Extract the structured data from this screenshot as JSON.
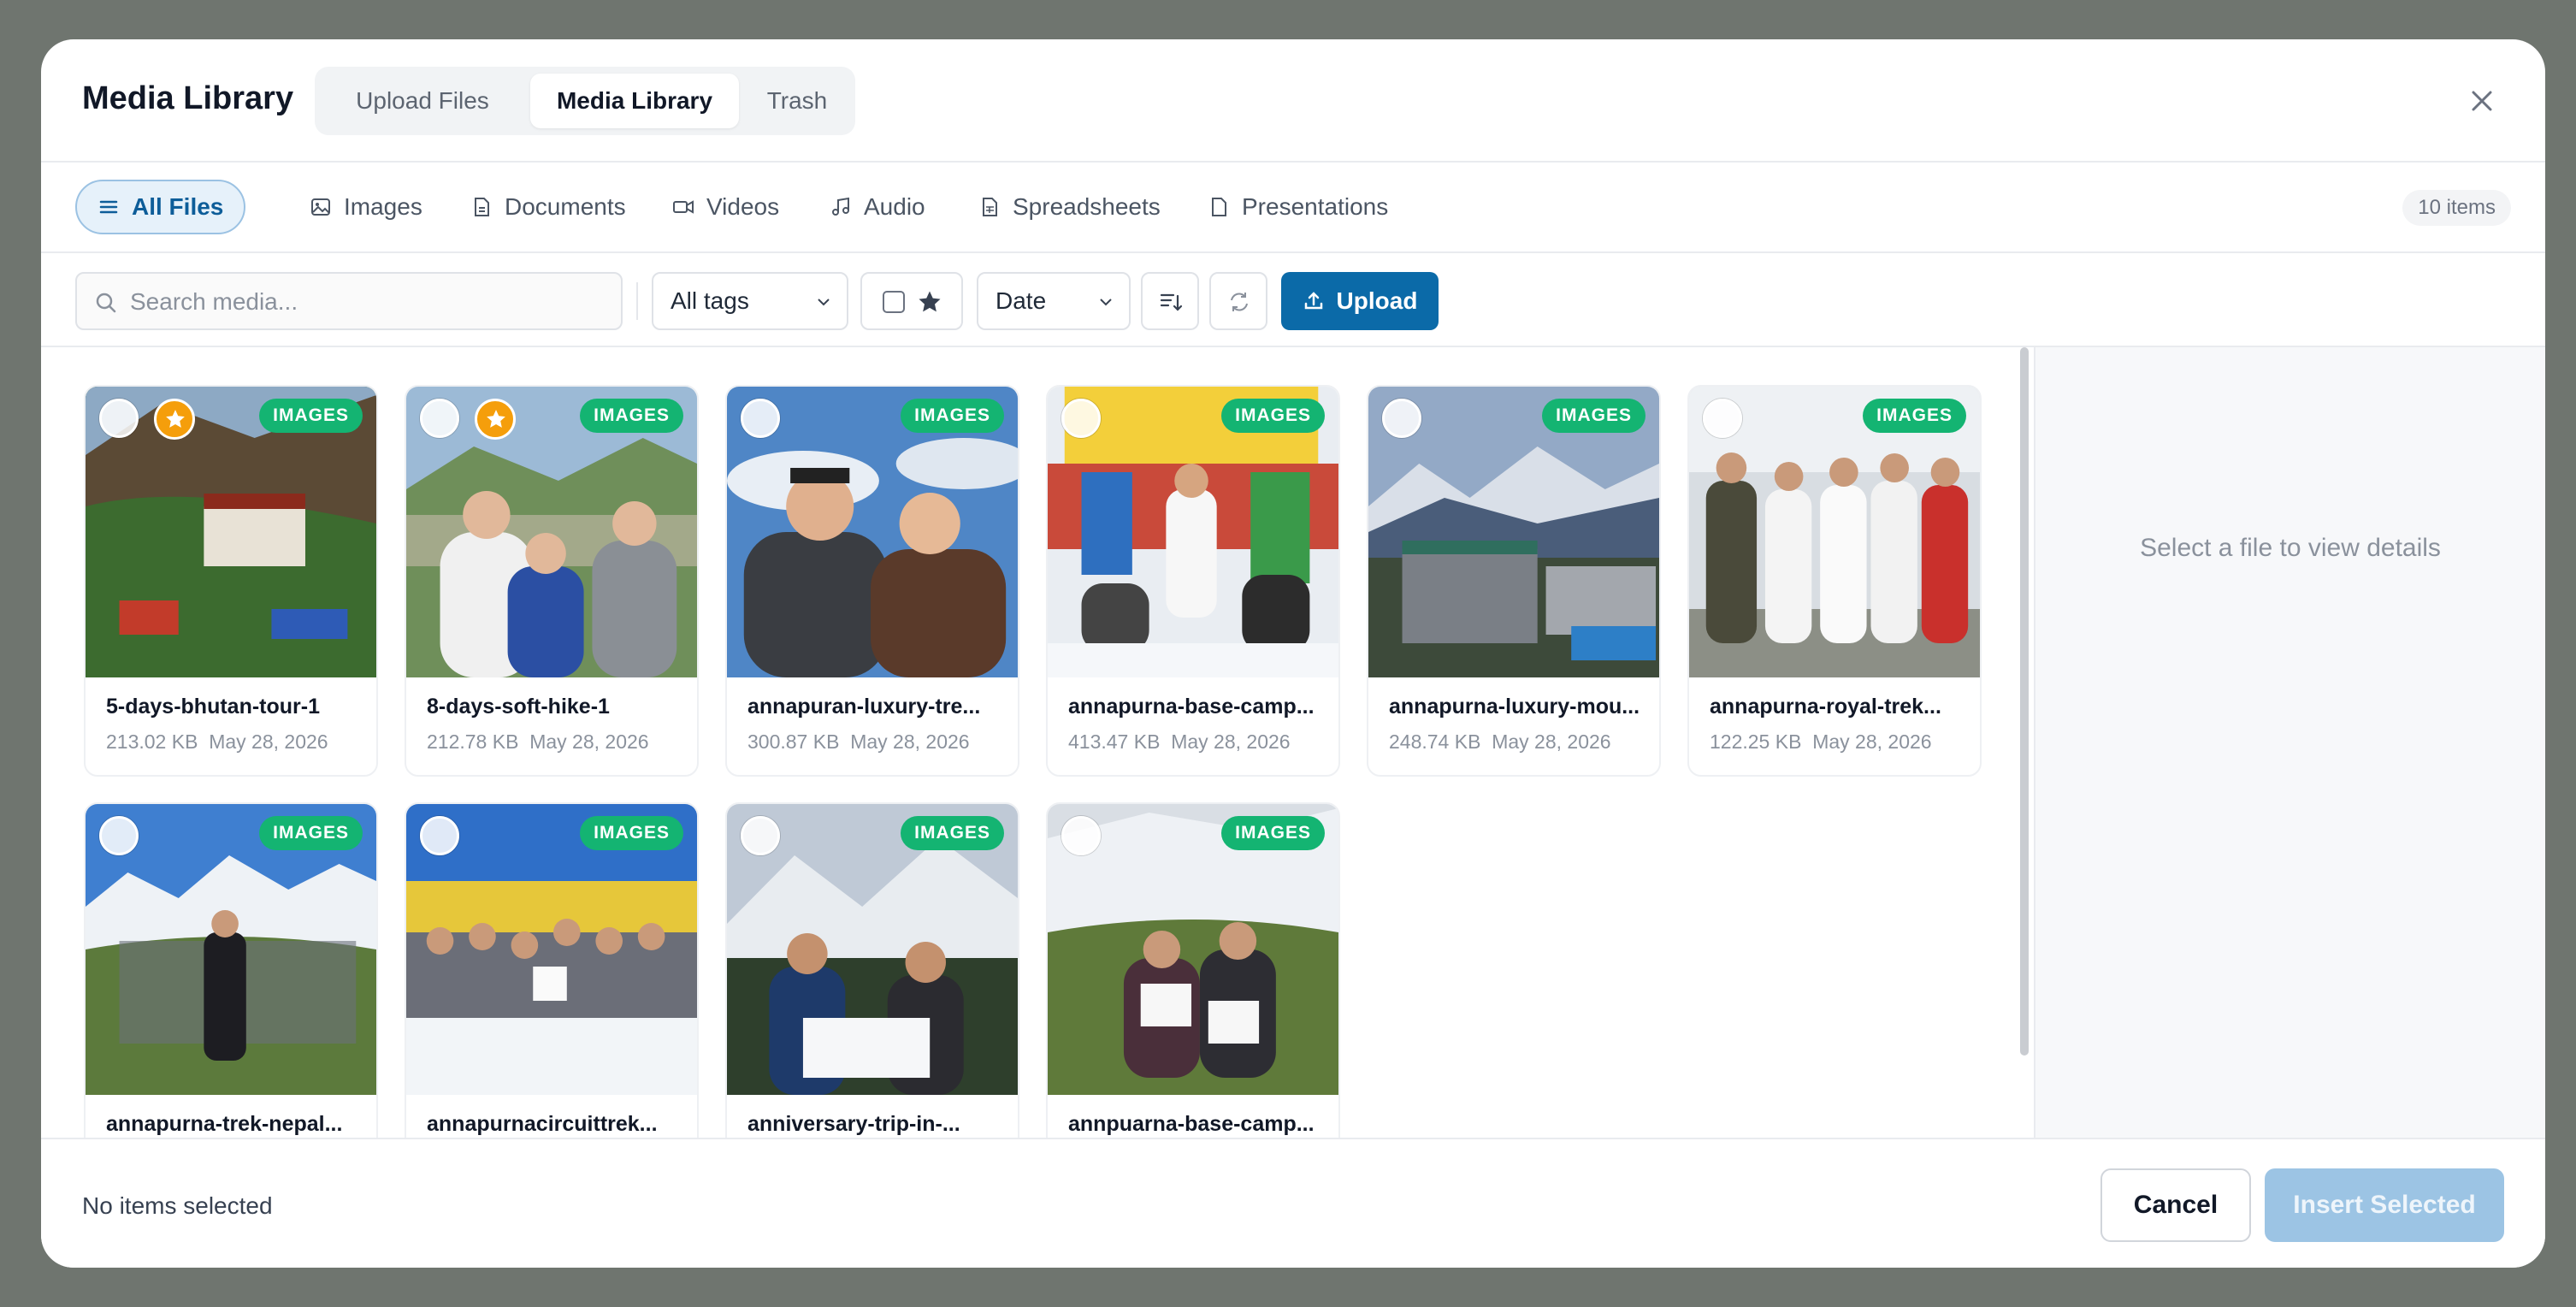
{
  "header": {
    "title": "Media Library",
    "tabs": [
      {
        "label": "Upload Files",
        "active": false
      },
      {
        "label": "Media Library",
        "active": true
      },
      {
        "label": "Trash",
        "active": false
      }
    ],
    "close_icon": "close-icon"
  },
  "filters": {
    "tabs": [
      {
        "label": "All Files",
        "icon": "list-icon",
        "active": true
      },
      {
        "label": "Images",
        "icon": "image-icon",
        "active": false
      },
      {
        "label": "Documents",
        "icon": "document-icon",
        "active": false
      },
      {
        "label": "Videos",
        "icon": "video-icon",
        "active": false
      },
      {
        "label": "Audio",
        "icon": "music-icon",
        "active": false
      },
      {
        "label": "Spreadsheets",
        "icon": "spreadsheet-icon",
        "active": false
      },
      {
        "label": "Presentations",
        "icon": "presentation-icon",
        "active": false
      }
    ],
    "count": "10 items"
  },
  "toolbar": {
    "search_placeholder": "Search media...",
    "tags_select": "All tags",
    "sort_select": "Date",
    "upload_label": "Upload"
  },
  "files": [
    {
      "name": "5-days-bhutan-tour-1",
      "size": "213.02 KB",
      "date": "May 28, 2026",
      "badge": "IMAGES",
      "starred": true
    },
    {
      "name": "8-days-soft-hike-1",
      "size": "212.78 KB",
      "date": "May 28, 2026",
      "badge": "IMAGES",
      "starred": true
    },
    {
      "name": "annapuran-luxury-tre...",
      "size": "300.87 KB",
      "date": "May 28, 2026",
      "badge": "IMAGES",
      "starred": false
    },
    {
      "name": "annapurna-base-camp...",
      "size": "413.47 KB",
      "date": "May 28, 2026",
      "badge": "IMAGES",
      "starred": false
    },
    {
      "name": "annapurna-luxury-mou...",
      "size": "248.74 KB",
      "date": "May 28, 2026",
      "badge": "IMAGES",
      "starred": false
    },
    {
      "name": "annapurna-royal-trek...",
      "size": "122.25 KB",
      "date": "May 28, 2026",
      "badge": "IMAGES",
      "starred": false
    },
    {
      "name": "annapurna-trek-nepal...",
      "size": "",
      "date": "",
      "badge": "IMAGES",
      "starred": false
    },
    {
      "name": "annapurnacircuittrek...",
      "size": "",
      "date": "",
      "badge": "IMAGES",
      "starred": false
    },
    {
      "name": "anniversary-trip-in-...",
      "size": "",
      "date": "",
      "badge": "IMAGES",
      "starred": false
    },
    {
      "name": "annpuarna-base-camp...",
      "size": "",
      "date": "",
      "badge": "IMAGES",
      "starred": false
    }
  ],
  "details": {
    "placeholder": "Select a file to view details"
  },
  "footer": {
    "status": "No items selected",
    "cancel_label": "Cancel",
    "insert_label": "Insert Selected"
  },
  "colors": {
    "primary": "#0b6aa8",
    "badge": "#14b472",
    "star": "#f59e0b",
    "insert_disabled": "#9cc4e4"
  }
}
